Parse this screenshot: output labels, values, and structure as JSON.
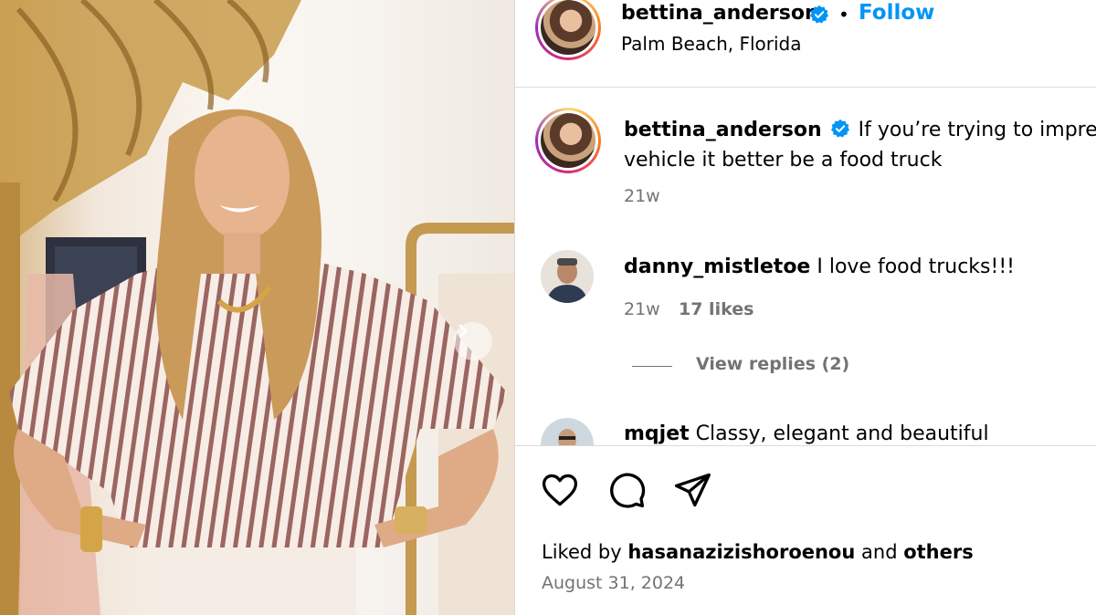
{
  "post": {
    "author": "bettina_anderson",
    "separator": "•",
    "follow_label": "Follow",
    "location": "Palm Beach, Florida",
    "caption_line1": "If you’re trying to impress",
    "caption_line2": "vehicle it better be a food truck",
    "caption_age": "21w"
  },
  "comments": [
    {
      "user": "danny_mistletoe",
      "text": "I love food trucks!!!",
      "age": "21w",
      "likes": "17 likes",
      "view_replies": "View replies (2)"
    },
    {
      "user": "mqjet",
      "text": "Classy, elegant and beautiful"
    }
  ],
  "footer": {
    "liked_prefix": "Liked by",
    "liked_user": "hasanazizishoroenou",
    "liked_and": "and",
    "liked_others": "others",
    "date": "August 31, 2024"
  },
  "icons": {
    "like": "heart-icon",
    "comment": "comment-icon",
    "share": "send-icon",
    "verified": "verified-badge-icon",
    "next": "chevron-right-icon"
  },
  "colors": {
    "link": "#0095f6",
    "verified": "#0095f6",
    "secondary_text": "#737373",
    "border": "#dbdbdb"
  }
}
